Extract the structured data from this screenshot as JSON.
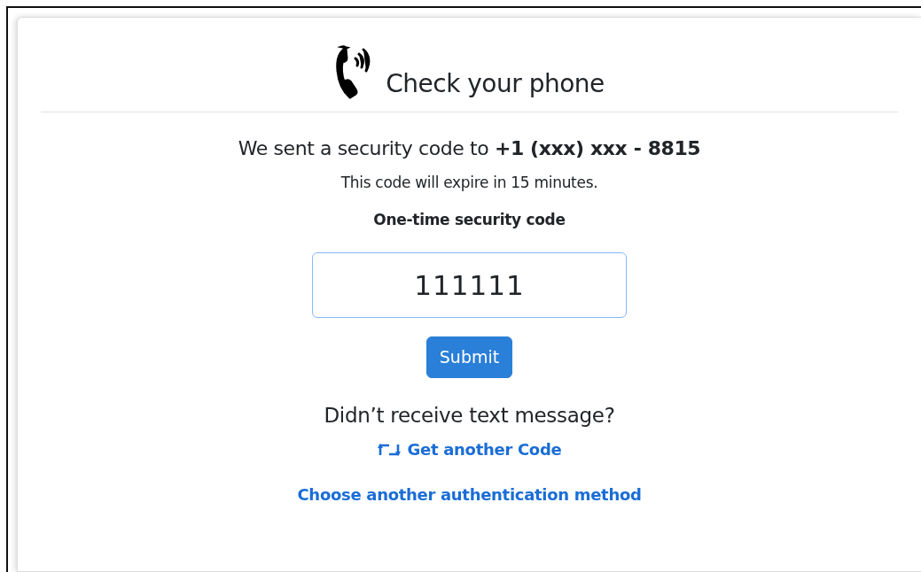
{
  "header": {
    "title": "Check your phone"
  },
  "message": "We sent a security code to **+1 (xxx) xxx - 8815**",
  "expiry": "This code will expire in 15 minutes.",
  "code_field": {
    "label": "One-time security code",
    "value": "111111",
    "focused": true
  },
  "submit_button": "Submit",
  "resend_prompt": "Didn’t receive text message?",
  "links": [
    {
      "kind": "resend",
      "label": "Get another Code"
    },
    {
      "kind": "plain",
      "label": "Choose another authentication method"
    }
  ]
}
